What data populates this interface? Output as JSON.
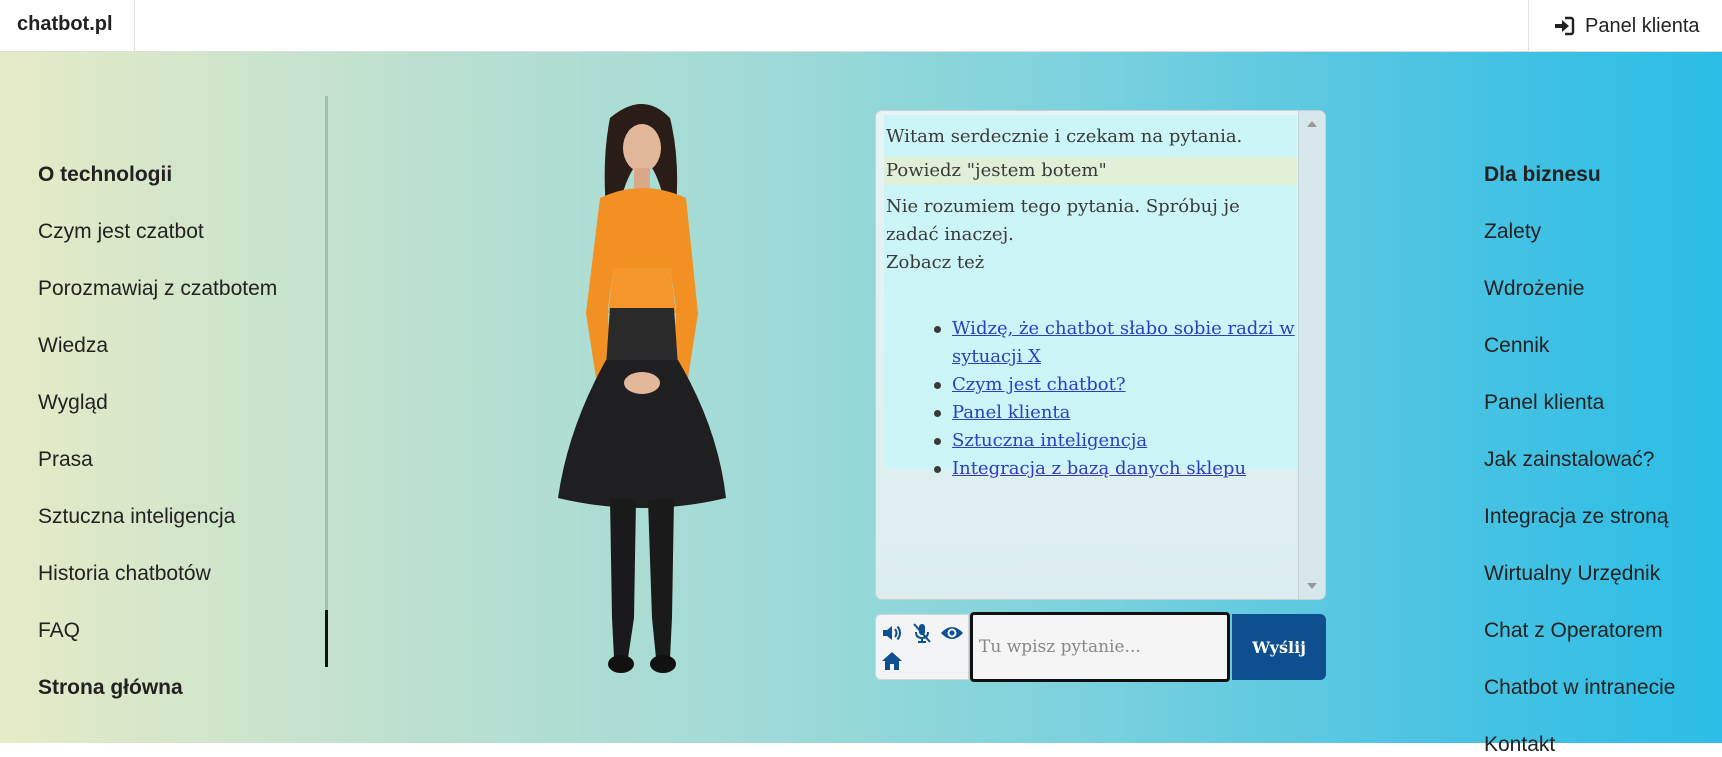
{
  "topbar": {
    "brand": "chatbot.pl",
    "panel_label": "Panel klienta"
  },
  "left_nav": {
    "heading": "O technologii",
    "items": [
      {
        "label": "Czym jest czatbot"
      },
      {
        "label": "Porozmawiaj z czatbotem"
      },
      {
        "label": "Wiedza"
      },
      {
        "label": "Wygląd"
      },
      {
        "label": "Prasa"
      },
      {
        "label": "Sztuczna inteligencja"
      },
      {
        "label": "Historia chatbotów"
      },
      {
        "label": "FAQ"
      }
    ],
    "active": "Strona główna"
  },
  "right_nav": {
    "heading": "Dla biznesu",
    "items": [
      {
        "label": "Zalety"
      },
      {
        "label": "Wdrożenie"
      },
      {
        "label": "Cennik"
      },
      {
        "label": "Panel klienta"
      },
      {
        "label": "Jak zainstalować?"
      },
      {
        "label": "Integracja ze stroną"
      },
      {
        "label": "Wirtualny Urzędnik"
      },
      {
        "label": "Chat z Operatorem"
      },
      {
        "label": "Chatbot w intranecie"
      },
      {
        "label": "Kontakt"
      }
    ]
  },
  "chat": {
    "greeting": "Witam serdecznie i czekam na pytania.",
    "user_message": "Powiedz \"jestem botem\"",
    "bot_reply_line1": "Nie rozumiem tego pytania. Spróbuj je",
    "bot_reply_line2": "zadać inaczej.",
    "see_also": "Zobacz też",
    "links": [
      {
        "label": "Widzę, że chatbot słabo sobie radzi w sytuacji X"
      },
      {
        "label": "Czym jest chatbot?"
      },
      {
        "label": "Panel klienta"
      },
      {
        "label": "Sztuczna inteligencja"
      },
      {
        "label": "Integracja z bazą danych sklepu"
      }
    ],
    "input_placeholder": "Tu wpisz pytanie...",
    "input_value": "",
    "send_label": "Wyślij"
  },
  "controls": {
    "icons": [
      "speaker-icon",
      "mic-muted-icon",
      "eye-icon",
      "home-icon"
    ]
  },
  "colors": {
    "send_button": "#0d4f8f",
    "chat_bg": "#cbf5f6",
    "user_message_bg": "#e0efd8",
    "link": "#2b3fbf"
  }
}
